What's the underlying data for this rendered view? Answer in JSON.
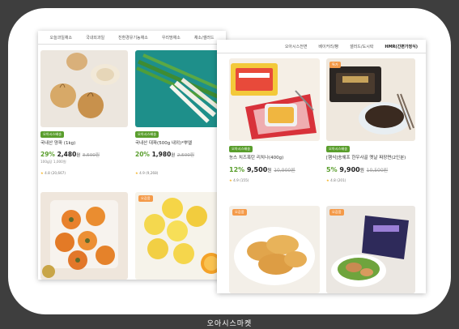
{
  "left_panel": {
    "tabs": [
      "오늘과일채소",
      "국내외과일",
      "친환경유기농채소",
      "우리땅채소",
      "채소/샐러드"
    ],
    "products": [
      {
        "tag": "오아시스배송",
        "name": "국내산 양파 (1kg)",
        "sub": "100g당 1,000원",
        "discount": "29%",
        "price": "2,480",
        "unit": "원",
        "original": "3,500원",
        "rating": "4.8",
        "reviews": "(20,667)"
      },
      {
        "tag": "오아시스배송",
        "name": "국내산 대파(500g 내외)*뿌엘",
        "sub": "",
        "discount": "20%",
        "price": "1,980",
        "unit": "원",
        "original": "2,500원",
        "rating": "4.9",
        "reviews": "(9,268)"
      }
    ],
    "bottom_badges": [
      "오감품"
    ]
  },
  "right_panel": {
    "tabs": [
      "오아시스전면",
      "베이커리/빵",
      "샐러드/도시락",
      "HMR(간편가정식)"
    ],
    "products": [
      {
        "tag": "오아시스배송",
        "name": "농스 치즈폭탄 리치나(400g)",
        "discount": "12%",
        "price": "9,500",
        "unit": "원",
        "original": "10,900원",
        "rating": "4.9",
        "reviews": "(155)"
      },
      {
        "corner": "특가",
        "tag": "오아시스배송",
        "name": "[햄식]송쉐프 한우사골 옛날 짜장면(2인분)",
        "discount": "5%",
        "price": "9,900",
        "unit": "원",
        "original": "10,500원",
        "rating": "4.8",
        "reviews": "(201)"
      }
    ],
    "bottom_badges": [
      "오감품",
      "오감품"
    ]
  },
  "caption": "오아시스마켓",
  "colors": {
    "green": "#5a9e2d",
    "orange": "#f49a49",
    "background": "#3e3e3e"
  }
}
